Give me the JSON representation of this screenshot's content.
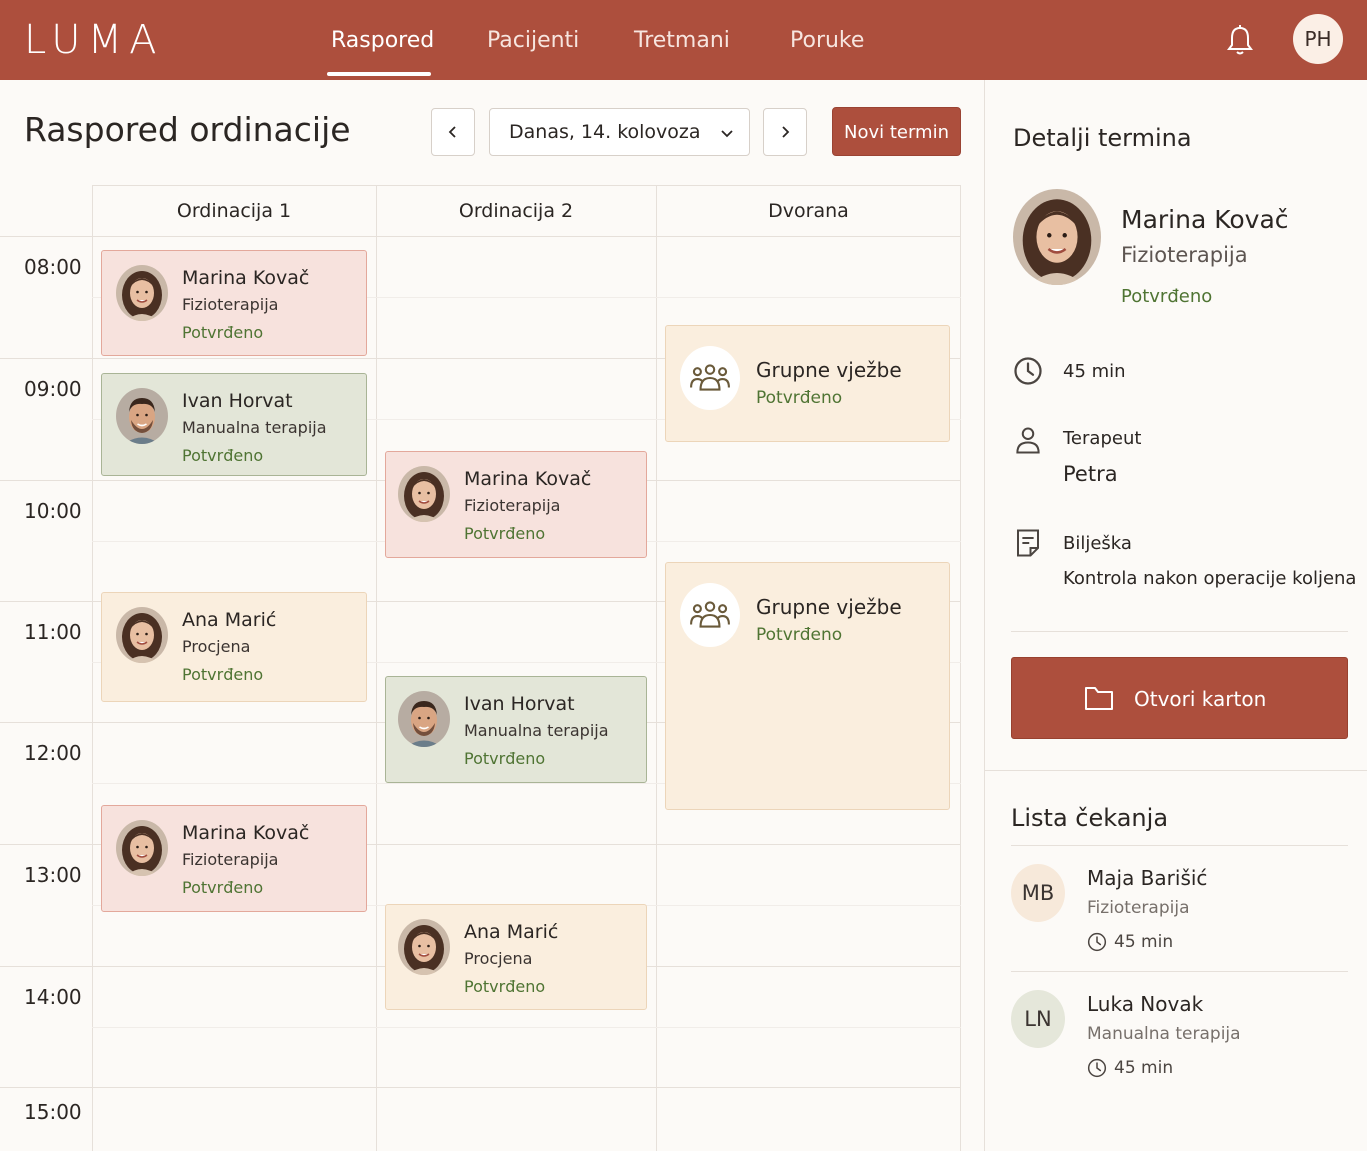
{
  "app": {
    "logo": "LUMA",
    "user_initials": "PH"
  },
  "nav": {
    "items": [
      "Raspored",
      "Pacijenti",
      "Tretmani",
      "Poruke"
    ],
    "active": "Raspored"
  },
  "header": {
    "title": "Raspored ordinacije",
    "date": "Danas, 14. kolovoza",
    "new_button": "Novi termin"
  },
  "calendar": {
    "columns": [
      "Ordinacija 1",
      "Ordinacija 2",
      "Dvorana"
    ],
    "times": [
      "08:00",
      "09:00",
      "10:00",
      "11:00",
      "12:00",
      "13:00",
      "14:00",
      "15:00"
    ],
    "events": [
      {
        "name": "Marina Kovač",
        "type": "Fizioterapija",
        "status": "Potvrđeno",
        "color": "pink",
        "avatar": "female-avatar"
      },
      {
        "name": "Ivan Horvat",
        "type": "Manualna terapija",
        "status": "Potvrđeno",
        "color": "green",
        "avatar": "male-avatar"
      },
      {
        "name": "Ana Marić",
        "type": "Procjena",
        "status": "Potvrđeno",
        "color": "cream",
        "avatar": "female-avatar"
      },
      {
        "name": "Marina Kovač",
        "type": "Fizioterapija",
        "status": "Potvrđeno",
        "color": "pink",
        "avatar": "female-avatar"
      },
      {
        "name": "Marina Kovač",
        "type": "Fizioterapija",
        "status": "Potvrđeno",
        "color": "pink",
        "avatar": "female-avatar"
      },
      {
        "name": "Ivan Horvat",
        "type": "Manualna terapija",
        "status": "Potvrđeno",
        "color": "green",
        "avatar": "male-avatar"
      },
      {
        "name": "Ana Marić",
        "type": "Procjena",
        "status": "Potvrđeno",
        "color": "cream",
        "avatar": "female-avatar"
      },
      {
        "name": "Grupne vježbe",
        "status": "Potvrđeno",
        "color": "cream",
        "icon": "group-icon"
      },
      {
        "name": "Grupne vježbe",
        "status": "Potvrđeno",
        "color": "cream",
        "icon": "group-icon"
      }
    ]
  },
  "details": {
    "title": "Detalji termina",
    "name": "Marina Kovač",
    "type": "Fizioterapija",
    "status": "Potvrđeno",
    "duration": "45 min",
    "therapist_label": "Terapeut",
    "therapist": "Petra",
    "note_label": "Bilješka",
    "note": "Kontrola nakon operacije koljena",
    "open_button": "Otvori karton"
  },
  "waitlist": {
    "title": "Lista čekanja",
    "items": [
      {
        "initials": "MB",
        "name": "Maja Barišić",
        "type": "Fizioterapija",
        "duration": "45 min"
      },
      {
        "initials": "LN",
        "name": "Luka Novak",
        "type": "Manualna terapija",
        "duration": "45 min"
      }
    ]
  },
  "colors": {
    "brand": "#ad4f3d",
    "confirmed": "#4f7433",
    "pink": "#f7e2dd",
    "green": "#e3e6d8",
    "cream": "#faeede"
  }
}
